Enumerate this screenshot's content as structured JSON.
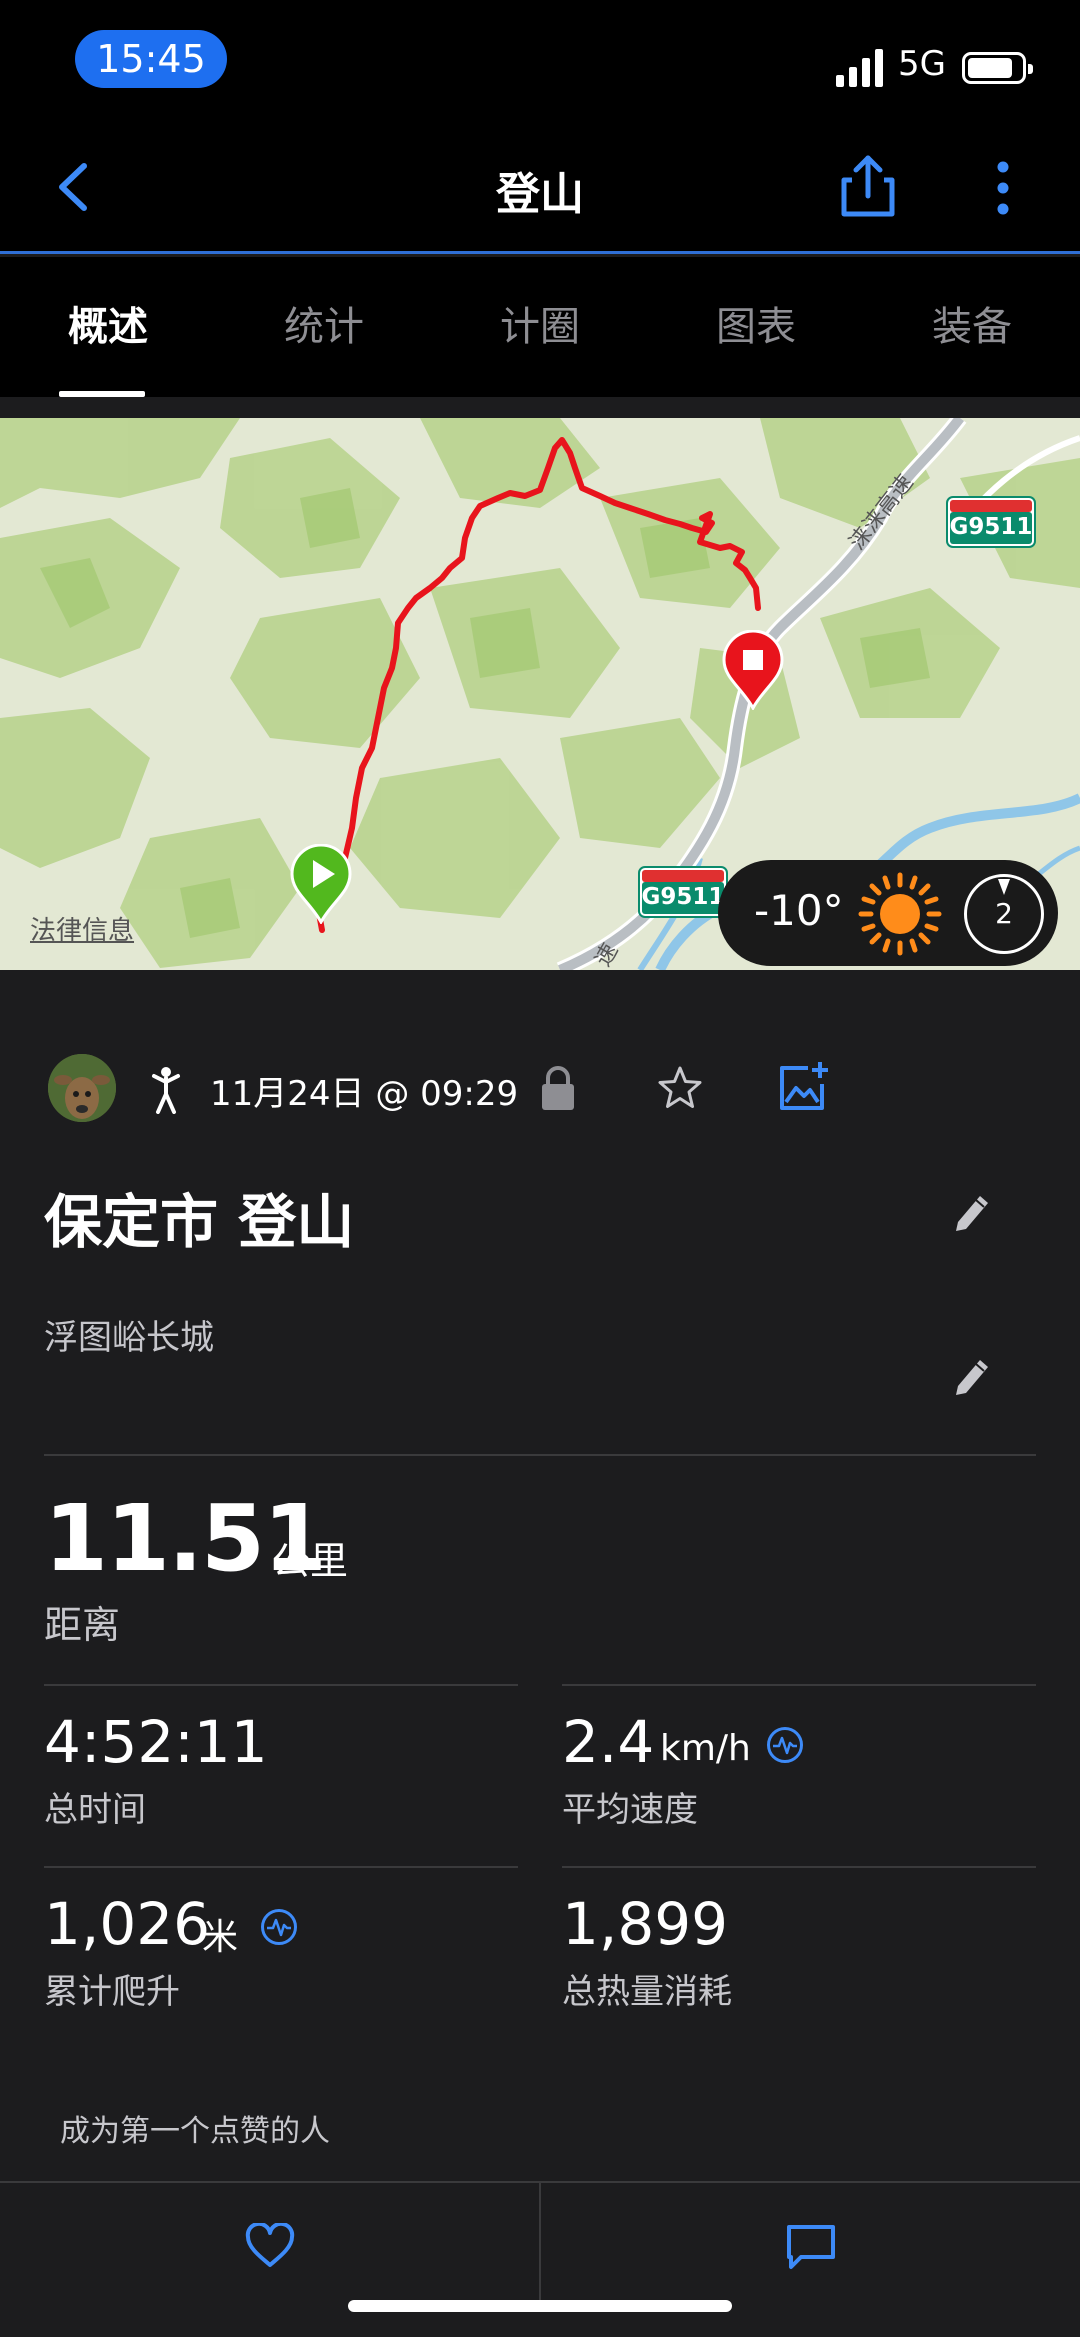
{
  "status_bar": {
    "time": "15:45",
    "network": "5G"
  },
  "header": {
    "title": "登山"
  },
  "tabs": [
    {
      "label": "概述",
      "active": true
    },
    {
      "label": "统计"
    },
    {
      "label": "计圈"
    },
    {
      "label": "图表"
    },
    {
      "label": "装备"
    }
  ],
  "map": {
    "legal_text": "法律信息",
    "road_shields": [
      "G9511",
      "G9511"
    ],
    "road_label": "涞涞高速",
    "road_label_fragment": "速",
    "weather": {
      "temperature": "-10°",
      "condition_icon": "sun-icon",
      "badge_number": "2"
    }
  },
  "activity": {
    "date": "11月24日 @ 09:29",
    "type_icon": "hiker-icon",
    "name": "保定市 登山",
    "description": "浮图峪长城"
  },
  "stats": {
    "distance": {
      "value": "11.51",
      "unit": "公里",
      "label": "距离"
    },
    "total_time": {
      "value": "4:52:11",
      "label": "总时间"
    },
    "avg_speed": {
      "value": "2.4",
      "unit": "km/h",
      "label": "平均速度"
    },
    "elevation_gain": {
      "value": "1,026",
      "unit": "米",
      "label": "累计爬升"
    },
    "calories": {
      "value": "1,899",
      "label": "总热量消耗"
    }
  },
  "social": {
    "like_prompt": "成为第一个点赞的人"
  },
  "colors": {
    "accent": "#3d8af7",
    "route": "#e8141c",
    "start_marker": "#52b81e",
    "sun": "#ff8c1a"
  }
}
